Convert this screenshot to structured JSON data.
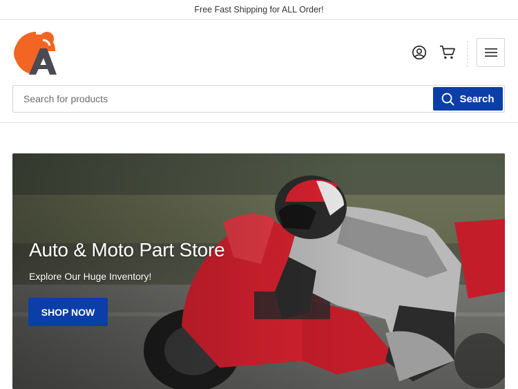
{
  "announcement": {
    "text": "Free Fast Shipping for ALL Order!"
  },
  "header": {
    "logo_letters": "CA",
    "account_icon": "user-circle-icon",
    "cart_icon": "cart-icon",
    "menu_icon": "hamburger-menu-icon"
  },
  "search": {
    "placeholder": "Search for products",
    "value": "",
    "button_label": "Search",
    "button_icon": "search-icon"
  },
  "hero": {
    "title": "Auto & Moto Part Store",
    "subtitle": "Explore Our Huge Inventory!",
    "cta_label": "SHOP NOW",
    "image_subject": "motorcycle-racer"
  },
  "colors": {
    "brand_orange": "#f26522",
    "brand_dark": "#4a4a52",
    "primary_blue": "#0b3ea8",
    "bike_red": "#d6212f"
  }
}
